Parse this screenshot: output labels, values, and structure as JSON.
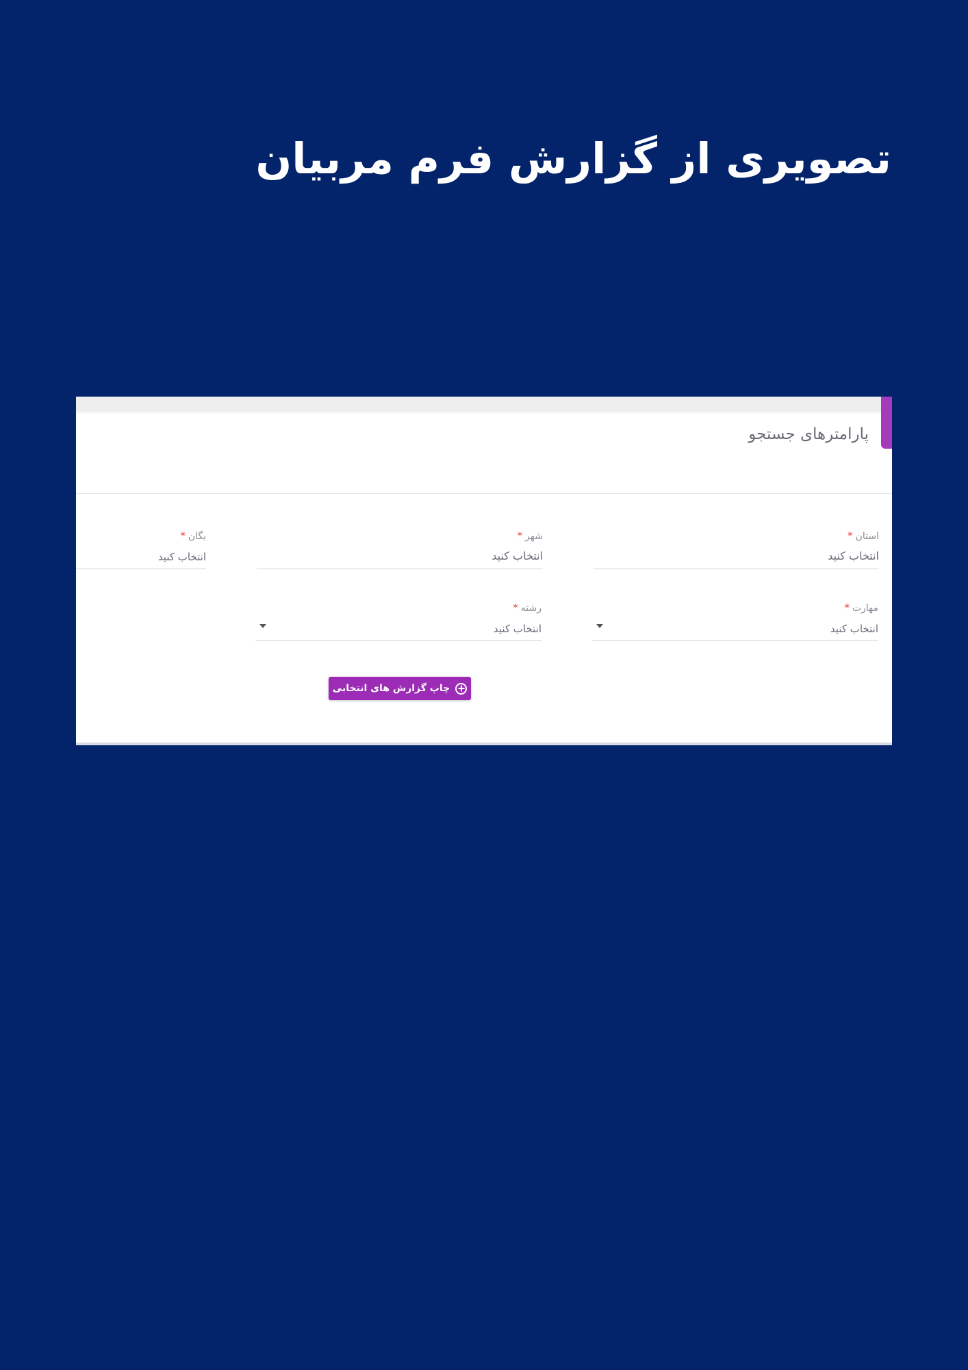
{
  "page": {
    "title": "تصویری از گزارش فرم مربیان"
  },
  "card": {
    "title": "پارامترهای جستجو",
    "accent_color": "#a43bbd"
  },
  "fields": {
    "province": {
      "label": "استان",
      "required_mark": "*",
      "value": "انتخاب کنید"
    },
    "city": {
      "label": "شهر",
      "required_mark": "*",
      "value": "انتخاب کنید"
    },
    "unit": {
      "label": "یگان",
      "required_mark": "*",
      "value": "انتخاب کنید"
    },
    "skill": {
      "label": "مهارت",
      "required_mark": "*",
      "value": "انتخاب کنید"
    },
    "field_of_study": {
      "label": "رشته",
      "required_mark": "*",
      "value": "انتخاب کنید"
    }
  },
  "actions": {
    "print_label": "چاپ گزارش های انتخابی",
    "print_icon": "plus-circle-icon",
    "button_color": "#9c2bb5"
  },
  "colors": {
    "background": "#03236b",
    "required": "#ef3b3b"
  }
}
